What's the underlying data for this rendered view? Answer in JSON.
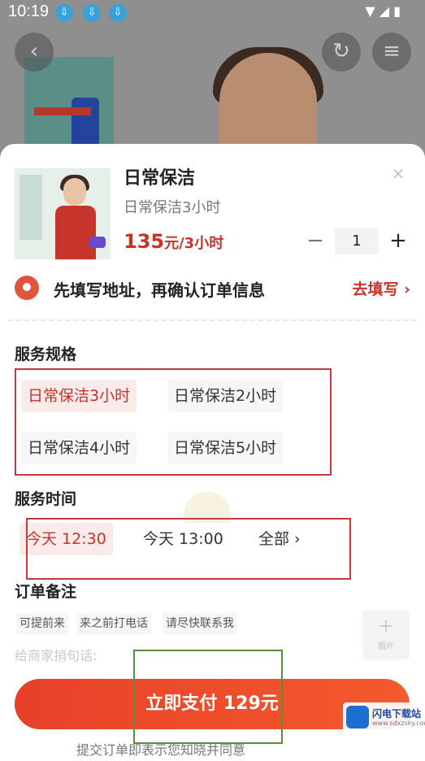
{
  "status": {
    "time": "10:19"
  },
  "product": {
    "title": "日常保洁",
    "subtitle": "日常保洁3小时",
    "price_number": "135",
    "price_unit": "元/3小时",
    "quantity": "1"
  },
  "address": {
    "prompt": "先填写地址，再确认订单信息",
    "action": "去填写"
  },
  "spec": {
    "label": "服务规格",
    "options": [
      "日常保洁3小时",
      "日常保洁2小时",
      "日常保洁4小时",
      "日常保洁5小时"
    ],
    "selected_index": 0
  },
  "time": {
    "label": "服务时间",
    "options": [
      "今天 12:30",
      "今天 13:00",
      "全部"
    ],
    "selected_index": 0
  },
  "notes": {
    "label": "订单备注",
    "quick_tags": [
      "可提前来",
      "来之前打电话",
      "请尽快联系我"
    ],
    "placeholder": "给商家捎句话:"
  },
  "pay": {
    "label": "立即支付 129元"
  },
  "agreement": "提交订单即表示您知晓并同意",
  "watermark": {
    "name": "闪电下载站",
    "url": "www.sdxzsky.com"
  },
  "colors": {
    "accent": "#c6352c",
    "pay_button": "#ee4a2b"
  }
}
